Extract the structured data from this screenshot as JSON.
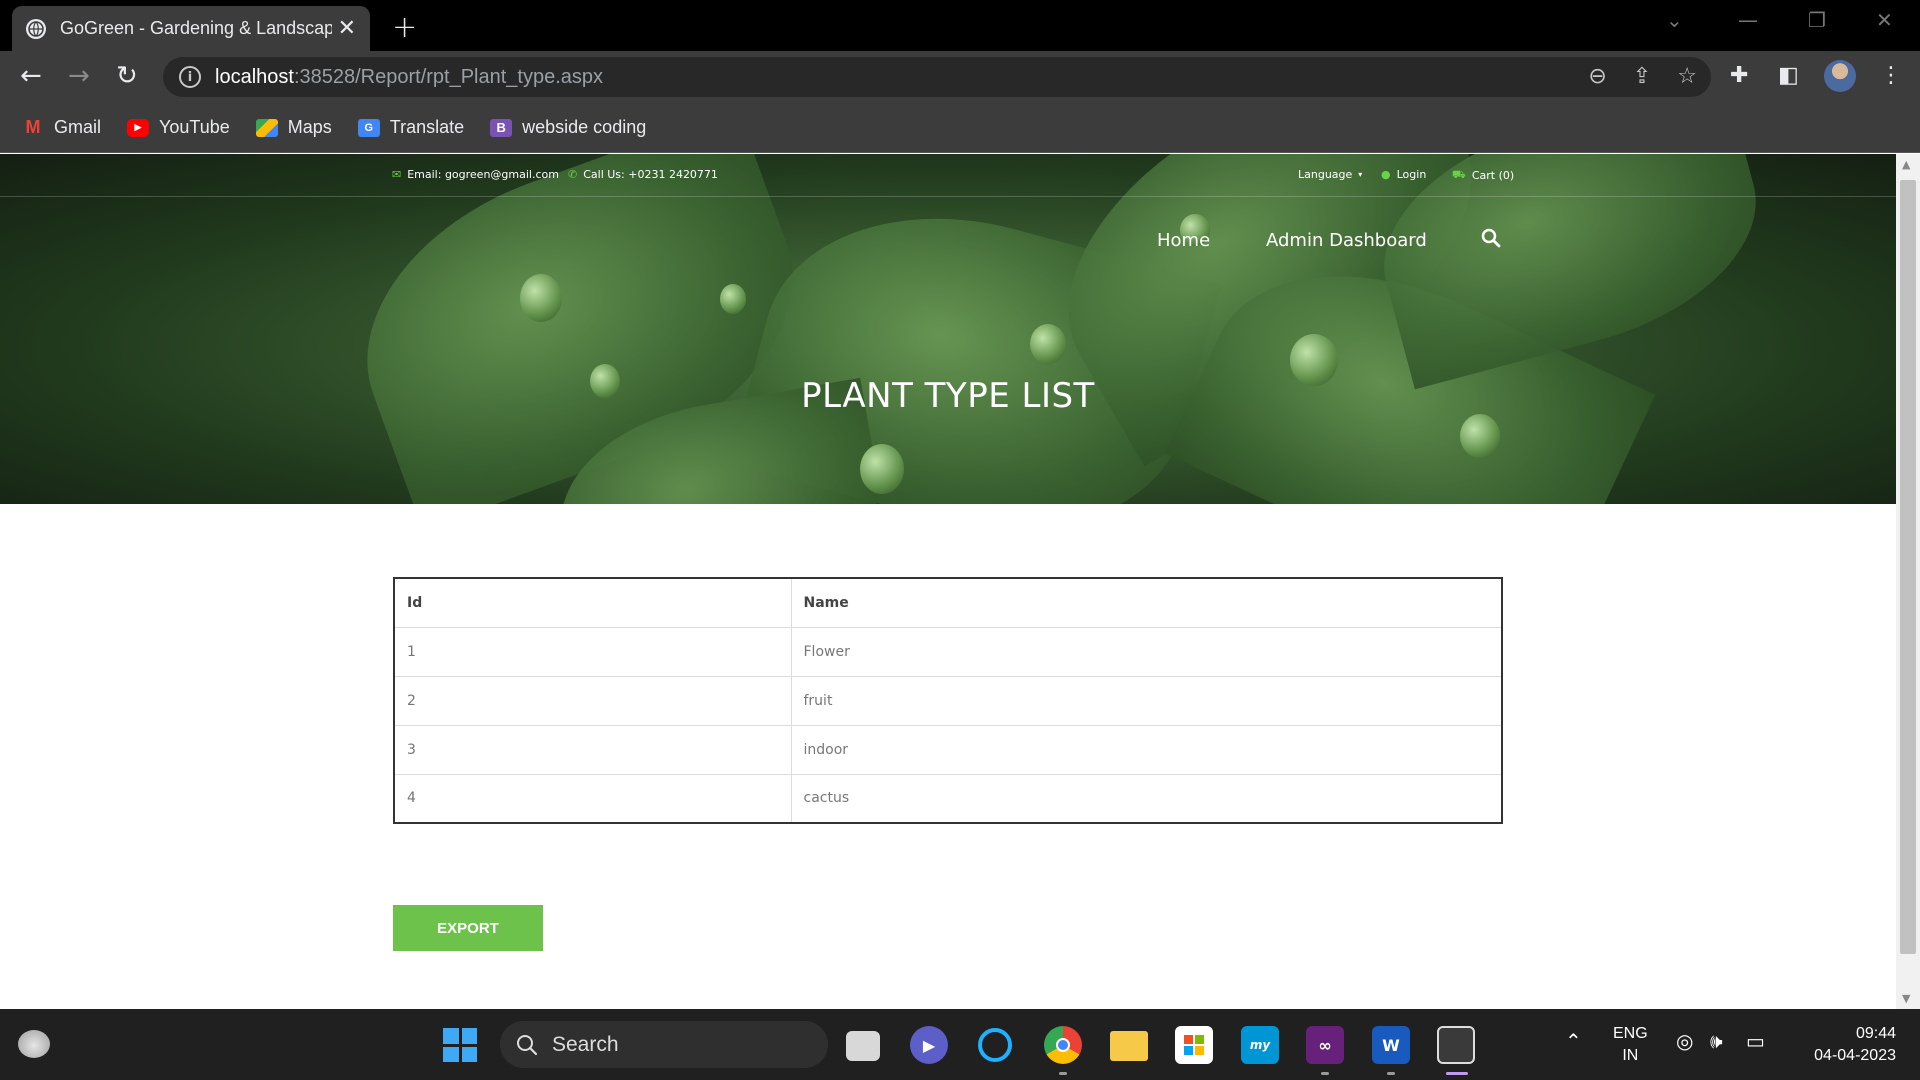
{
  "browser": {
    "tab_title": "GoGreen - Gardening & Landscap",
    "url_host": "localhost",
    "url_path": ":38528/Report/rpt_Plant_type.aspx",
    "bookmarks": [
      {
        "label": "Gmail",
        "icon": "gmail-icon",
        "color": "#ea4335"
      },
      {
        "label": "YouTube",
        "icon": "youtube-icon",
        "color": "#ff0000"
      },
      {
        "label": "Maps",
        "icon": "maps-icon",
        "color": "#34a853"
      },
      {
        "label": "Translate",
        "icon": "translate-icon",
        "color": "#4285f4"
      },
      {
        "label": "webside coding",
        "icon": "bootstrap-icon",
        "color": "#7952b3"
      }
    ]
  },
  "site": {
    "email": "Email: gogreen@gmail.com",
    "phone": "Call Us: +0231 2420771",
    "language": "Language",
    "login": "Login",
    "cart": "Cart (0)",
    "nav": {
      "home": "Home",
      "admin": "Admin Dashboard"
    },
    "title": "PLANT TYPE LIST",
    "accent": "#6cc24a"
  },
  "table": {
    "headers": [
      "Id",
      "Name"
    ],
    "rows": [
      [
        "1",
        "Flower"
      ],
      [
        "2",
        "fruit"
      ],
      [
        "3",
        "indoor"
      ],
      [
        "4",
        "cactus"
      ]
    ]
  },
  "export_label": "EXPORT",
  "taskbar": {
    "search_label": "Search",
    "lang_line1": "ENG",
    "lang_line2": "IN",
    "time": "09:44",
    "date": "04-04-2023"
  }
}
